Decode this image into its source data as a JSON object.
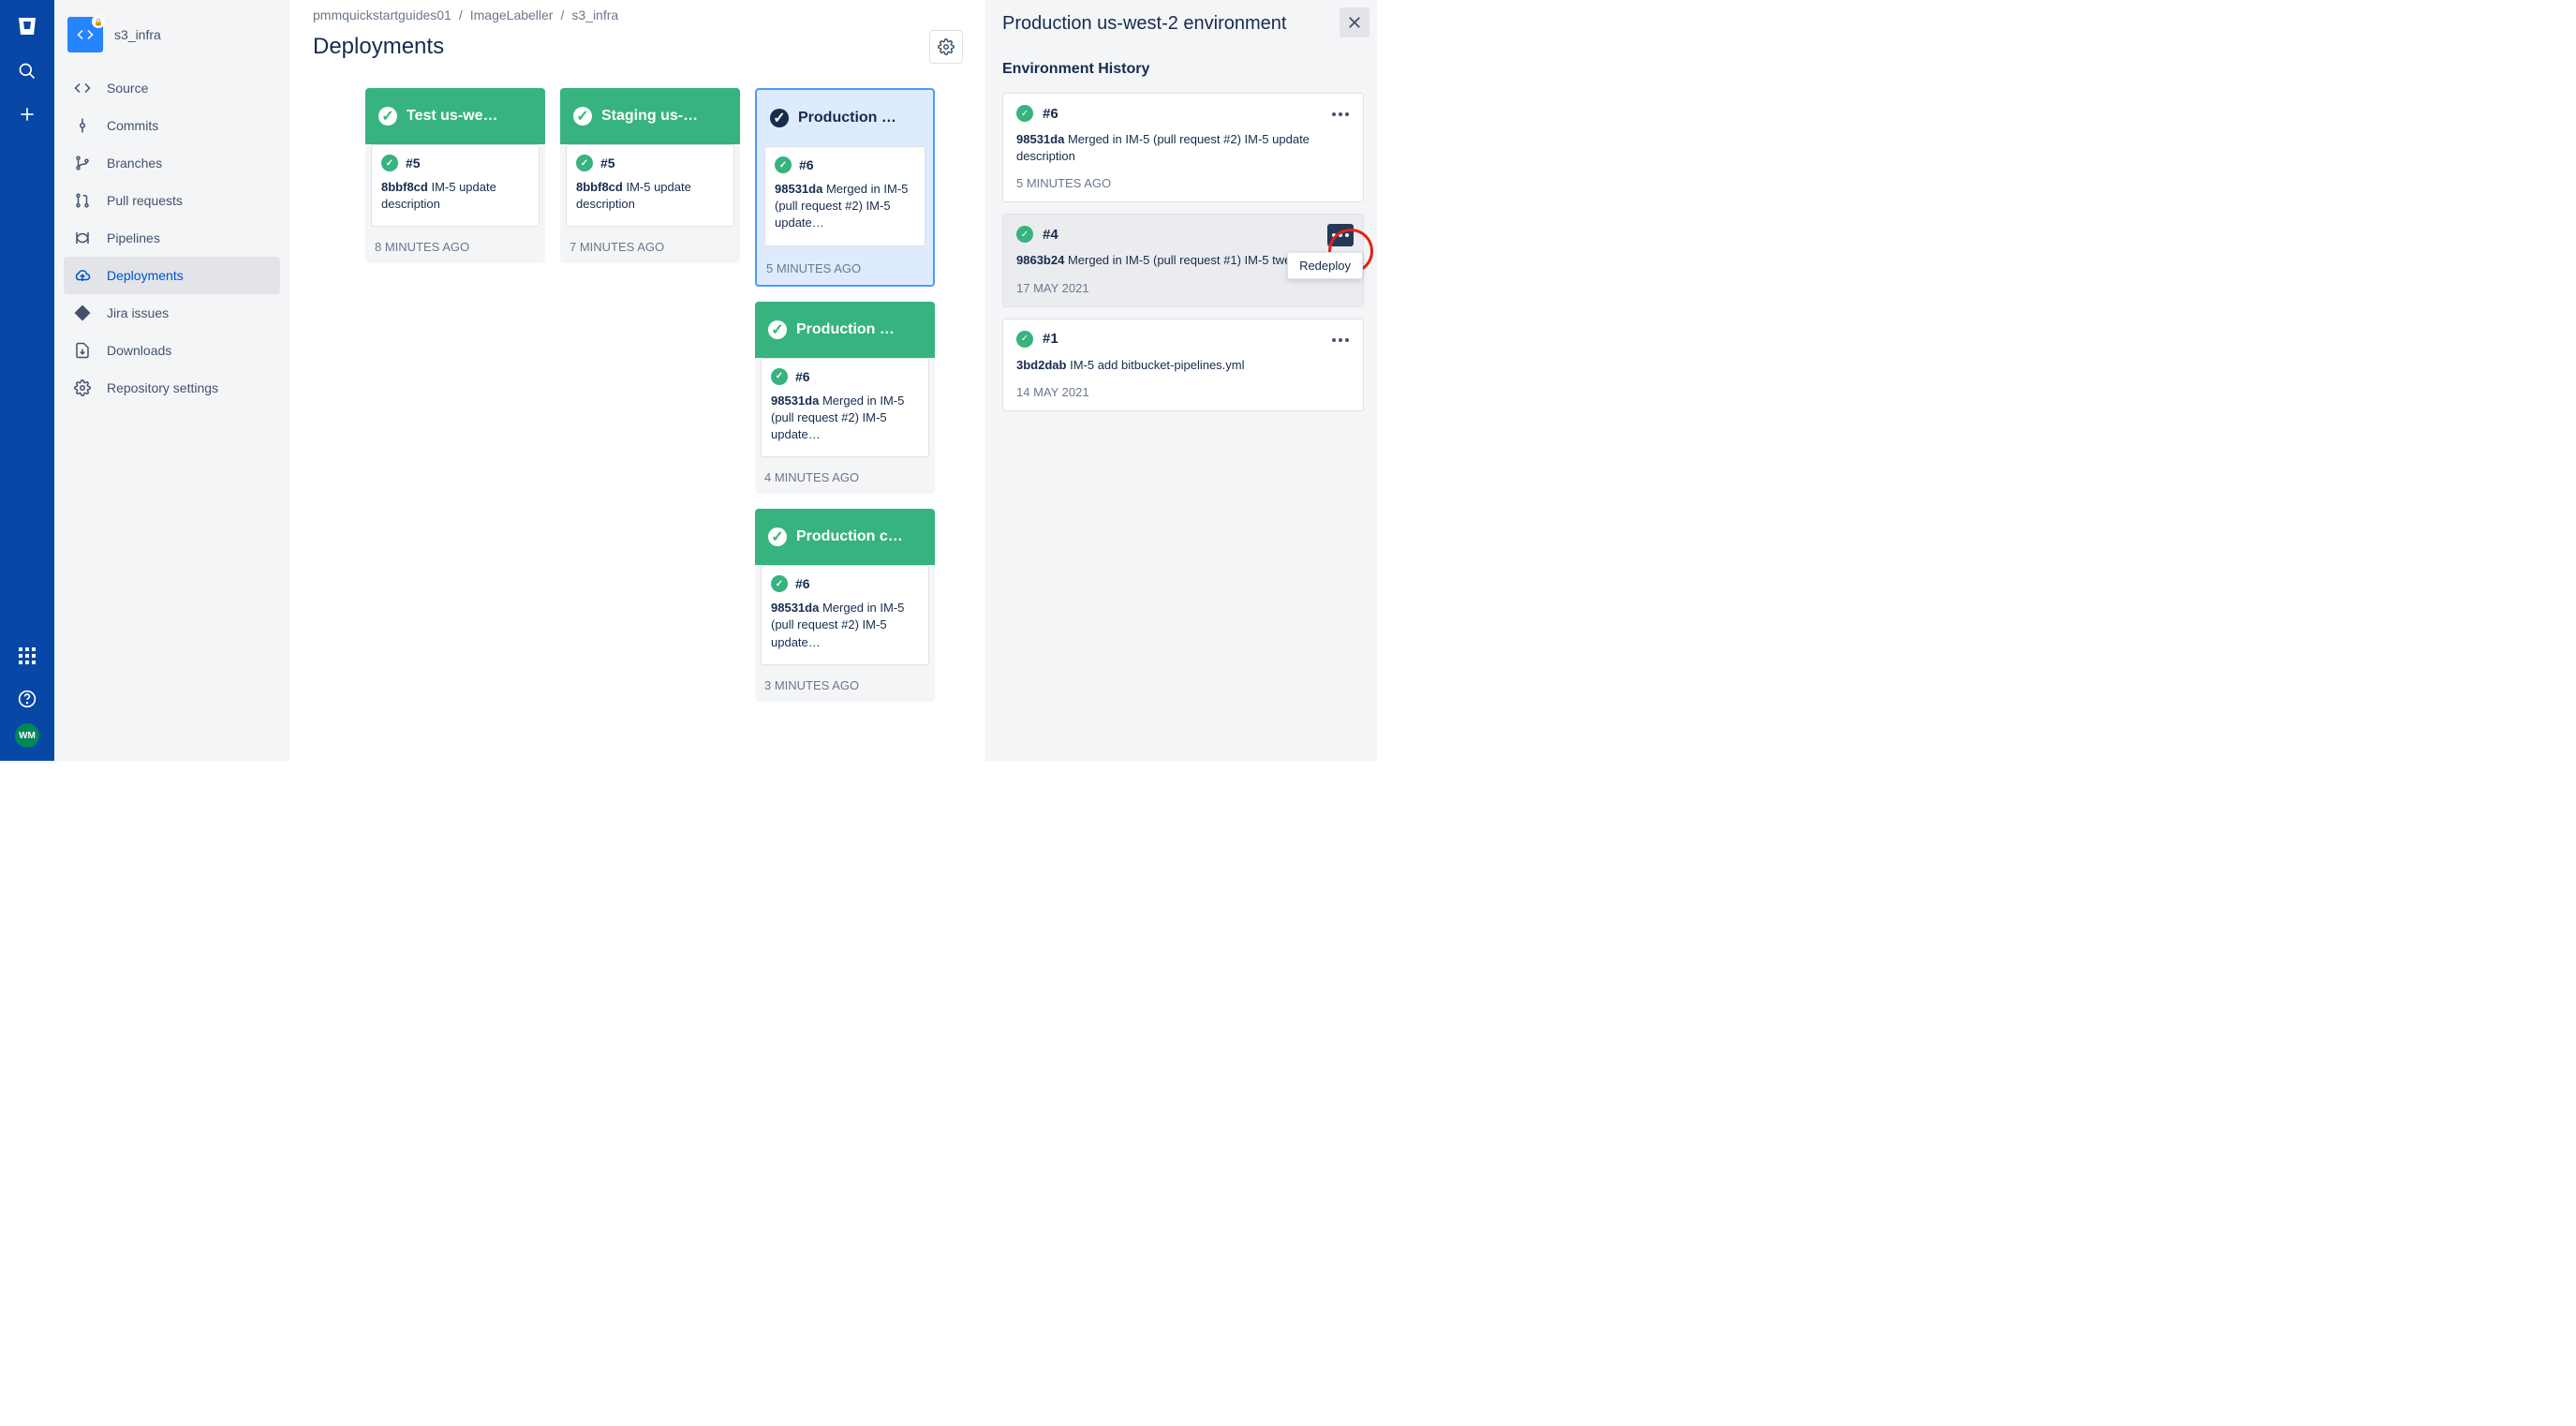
{
  "repo": {
    "name": "s3_infra"
  },
  "breadcrumbs": [
    "pmmquickstartguides01",
    "ImageLabeller",
    "s3_infra"
  ],
  "pageTitle": "Deployments",
  "nav": {
    "source": "Source",
    "commits": "Commits",
    "branches": "Branches",
    "pullrequests": "Pull requests",
    "pipelines": "Pipelines",
    "deployments": "Deployments",
    "jira": "Jira issues",
    "downloads": "Downloads",
    "settings": "Repository settings"
  },
  "avatarInitials": "WM",
  "columns": [
    {
      "env": "Test us-we…",
      "selected": false,
      "deployments": [
        {
          "num": "#5",
          "hash": "8bbf8cd",
          "msg": "IM-5 update description",
          "time": "8 MINUTES AGO"
        }
      ]
    },
    {
      "env": "Staging us-…",
      "selected": false,
      "deployments": [
        {
          "num": "#5",
          "hash": "8bbf8cd",
          "msg": "IM-5 update description",
          "time": "7 MINUTES AGO"
        }
      ]
    },
    {
      "env": "Production …",
      "selected": true,
      "deployments": [
        {
          "num": "#6",
          "hash": "98531da",
          "msg": "Merged in IM-5 (pull request #2) IM-5 update…",
          "time": "5 MINUTES AGO"
        }
      ],
      "extra": [
        {
          "env": "Production …",
          "num": "#6",
          "hash": "98531da",
          "msg": "Merged in IM-5 (pull request #2) IM-5 update…",
          "time": "4 MINUTES AGO"
        },
        {
          "env": "Production c…",
          "num": "#6",
          "hash": "98531da",
          "msg": "Merged in IM-5 (pull request #2) IM-5 update…",
          "time": "3 MINUTES AGO"
        }
      ]
    }
  ],
  "panel": {
    "title": "Production us-west-2 environment",
    "subtitle": "Environment History",
    "tooltip": "Redeploy",
    "history": [
      {
        "num": "#6",
        "hash": "98531da",
        "msg": "Merged in IM-5 (pull request #2) IM-5 update description",
        "time": "5 MINUTES AGO",
        "highlighted": false,
        "moreDark": false
      },
      {
        "num": "#4",
        "hash": "9863b24",
        "msg": "Merged in IM-5 (pull request #1) IM-5 tweak",
        "time": "17 MAY 2021",
        "highlighted": true,
        "moreDark": true
      },
      {
        "num": "#1",
        "hash": "3bd2dab",
        "msg": "IM-5 add bitbucket-pipelines.yml",
        "time": "14 MAY 2021",
        "highlighted": false,
        "moreDark": false
      }
    ]
  }
}
